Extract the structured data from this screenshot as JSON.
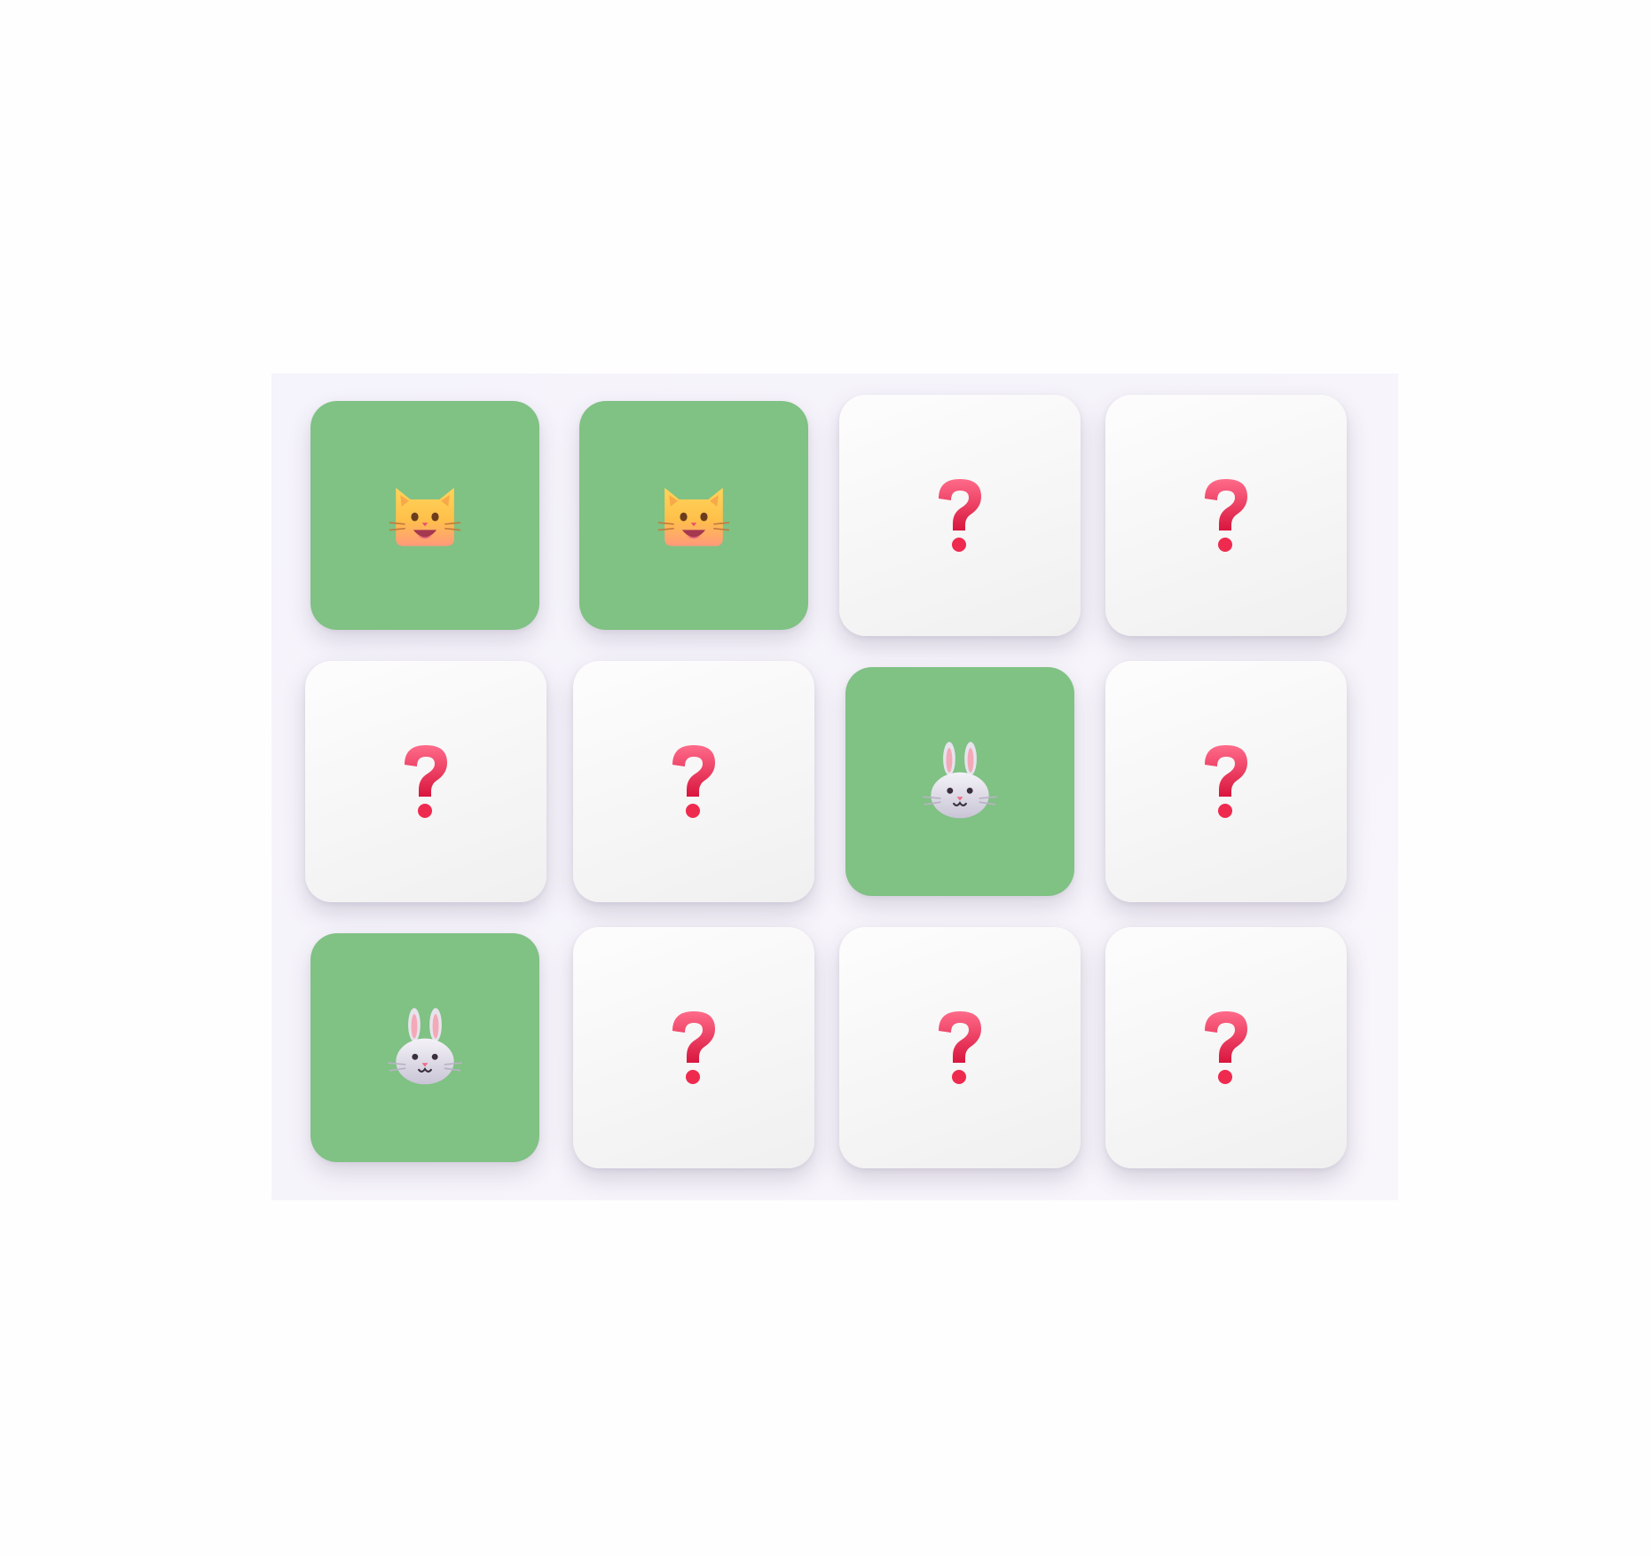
{
  "game": {
    "title": "",
    "colors": {
      "matched": "#80c184",
      "hidden": "#f6f6f6",
      "question_mark": "#e8214a",
      "board": "#f6f4fb"
    },
    "grid": {
      "rows": 3,
      "columns": 4
    },
    "cards": [
      {
        "state": "matched",
        "icon": "cat-face-icon"
      },
      {
        "state": "matched",
        "icon": "cat-face-icon"
      },
      {
        "state": "hidden",
        "icon": "question-mark-icon"
      },
      {
        "state": "hidden",
        "icon": "question-mark-icon"
      },
      {
        "state": "hidden",
        "icon": "question-mark-icon"
      },
      {
        "state": "hidden",
        "icon": "question-mark-icon"
      },
      {
        "state": "matched",
        "icon": "rabbit-face-icon"
      },
      {
        "state": "hidden",
        "icon": "question-mark-icon"
      },
      {
        "state": "matched",
        "icon": "rabbit-face-icon"
      },
      {
        "state": "hidden",
        "icon": "question-mark-icon"
      },
      {
        "state": "hidden",
        "icon": "question-mark-icon"
      },
      {
        "state": "hidden",
        "icon": "question-mark-icon"
      }
    ]
  }
}
